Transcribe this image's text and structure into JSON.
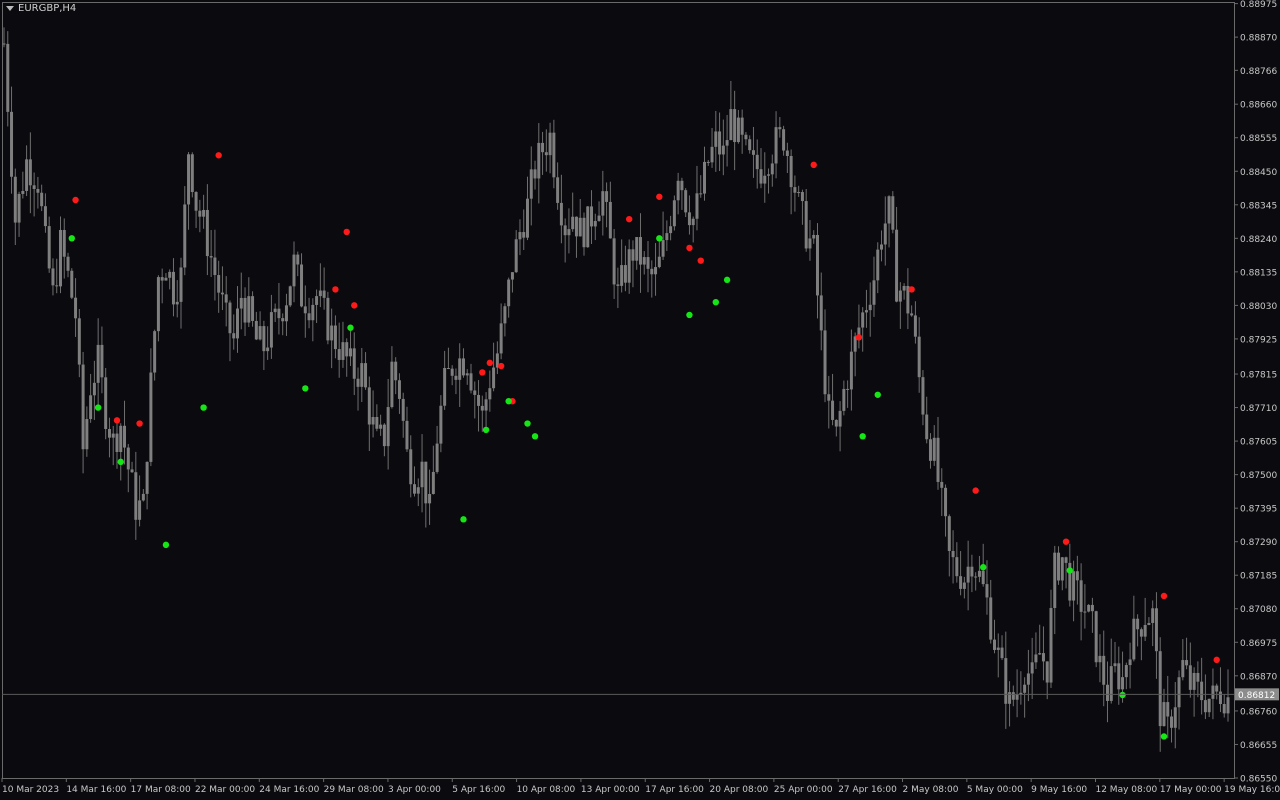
{
  "header": {
    "symbol_label": "EURGBP,H4"
  },
  "colors": {
    "background": "#0b0b0f",
    "frame": "#6a6a6a",
    "candle": "#7f7f7f",
    "wick": "#6f6f6f",
    "signal_up": "#ff1a1a",
    "signal_down": "#16e616",
    "current_price_line": "#5a5a5a",
    "price_tag_bg": "#8c8c8c",
    "price_tag_text": "#ffffff",
    "text": "#c8c8c8"
  },
  "chart_data": {
    "type": "candlestick",
    "title": "EURGBP,H4",
    "y_range": [
      0.8655,
      0.8898
    ],
    "y_ticks": [
      "0.88975",
      "0.88870",
      "0.88766",
      "0.88660",
      "0.88555",
      "0.88450",
      "0.88345",
      "0.88240",
      "0.88135",
      "0.88030",
      "0.87925",
      "0.87815",
      "0.87710",
      "0.87605",
      "0.87500",
      "0.87395",
      "0.87290",
      "0.87185",
      "0.87080",
      "0.86975",
      "0.86870",
      "0.86760",
      "0.86655",
      "0.86550"
    ],
    "x_ticks": [
      "10 Mar 2023",
      "14 Mar 16:00",
      "17 Mar 08:00",
      "22 Mar 00:00",
      "24 Mar 16:00",
      "29 Mar 08:00",
      "3 Apr 00:00",
      "5 Apr 16:00",
      "10 Apr 08:00",
      "13 Apr 00:00",
      "17 Apr 16:00",
      "20 Apr 08:00",
      "25 Apr 00:00",
      "27 Apr 16:00",
      "2 May 08:00",
      "5 May 00:00",
      "9 May 16:00",
      "12 May 08:00",
      "17 May 00:00",
      "19 May 16:00"
    ],
    "current_price": 0.86812,
    "current_price_label": "0.86812",
    "close_path": [
      [
        0,
        0.8885
      ],
      [
        3,
        0.883
      ],
      [
        6,
        0.8848
      ],
      [
        9,
        0.8842
      ],
      [
        11,
        0.8822
      ],
      [
        13,
        0.8806
      ],
      [
        15,
        0.8822
      ],
      [
        17,
        0.8812
      ],
      [
        19,
        0.88
      ],
      [
        21,
        0.8758
      ],
      [
        23,
        0.8778
      ],
      [
        25,
        0.8785
      ],
      [
        27,
        0.877
      ],
      [
        29,
        0.876
      ],
      [
        31,
        0.8766
      ],
      [
        33,
        0.8752
      ],
      [
        35,
        0.874
      ],
      [
        37,
        0.874
      ],
      [
        39,
        0.8778
      ],
      [
        41,
        0.8812
      ],
      [
        43,
        0.8816
      ],
      [
        45,
        0.8808
      ],
      [
        47,
        0.8812
      ],
      [
        49,
        0.8852
      ],
      [
        51,
        0.8835
      ],
      [
        53,
        0.8828
      ],
      [
        55,
        0.8818
      ],
      [
        57,
        0.8808
      ],
      [
        59,
        0.8798
      ],
      [
        61,
        0.8792
      ],
      [
        63,
        0.8806
      ],
      [
        65,
        0.88
      ],
      [
        67,
        0.8792
      ],
      [
        69,
        0.879
      ],
      [
        71,
        0.8796
      ],
      [
        73,
        0.88
      ],
      [
        75,
        0.8806
      ],
      [
        77,
        0.8816
      ],
      [
        79,
        0.8806
      ],
      [
        81,
        0.8804
      ],
      [
        83,
        0.8806
      ],
      [
        85,
        0.88
      ],
      [
        87,
        0.8794
      ],
      [
        89,
        0.879
      ],
      [
        91,
        0.8786
      ],
      [
        93,
        0.8782
      ],
      [
        95,
        0.8782
      ],
      [
        97,
        0.877
      ],
      [
        99,
        0.876
      ],
      [
        101,
        0.8762
      ],
      [
        103,
        0.8784
      ],
      [
        105,
        0.8776
      ],
      [
        107,
        0.8756
      ],
      [
        109,
        0.875
      ],
      [
        111,
        0.8752
      ],
      [
        113,
        0.8738
      ],
      [
        115,
        0.8762
      ],
      [
        117,
        0.8778
      ],
      [
        119,
        0.8784
      ],
      [
        121,
        0.8786
      ],
      [
        123,
        0.8786
      ],
      [
        125,
        0.8776
      ],
      [
        127,
        0.8768
      ],
      [
        129,
        0.878
      ],
      [
        131,
        0.8788
      ],
      [
        133,
        0.88
      ],
      [
        135,
        0.8816
      ],
      [
        137,
        0.8826
      ],
      [
        139,
        0.8834
      ],
      [
        141,
        0.8846
      ],
      [
        143,
        0.8852
      ],
      [
        145,
        0.8856
      ],
      [
        147,
        0.884
      ],
      [
        149,
        0.8828
      ],
      [
        151,
        0.8832
      ],
      [
        153,
        0.8826
      ],
      [
        155,
        0.8828
      ],
      [
        157,
        0.8834
      ],
      [
        159,
        0.8838
      ],
      [
        161,
        0.8822
      ],
      [
        163,
        0.8806
      ],
      [
        165,
        0.8814
      ],
      [
        167,
        0.882
      ],
      [
        169,
        0.8818
      ],
      [
        171,
        0.8812
      ],
      [
        173,
        0.8812
      ],
      [
        175,
        0.882
      ],
      [
        177,
        0.8832
      ],
      [
        179,
        0.8846
      ],
      [
        181,
        0.8836
      ],
      [
        183,
        0.883
      ],
      [
        185,
        0.8838
      ],
      [
        187,
        0.8848
      ],
      [
        189,
        0.8854
      ],
      [
        191,
        0.885
      ],
      [
        193,
        0.8862
      ],
      [
        195,
        0.8856
      ],
      [
        197,
        0.885
      ],
      [
        199,
        0.8846
      ],
      [
        201,
        0.8846
      ],
      [
        203,
        0.885
      ],
      [
        205,
        0.8854
      ],
      [
        207,
        0.8856
      ],
      [
        209,
        0.8846
      ],
      [
        211,
        0.8834
      ],
      [
        213,
        0.8826
      ],
      [
        215,
        0.882
      ],
      [
        217,
        0.8792
      ],
      [
        219,
        0.8768
      ],
      [
        221,
        0.8762
      ],
      [
        223,
        0.8776
      ],
      [
        225,
        0.8786
      ],
      [
        227,
        0.8796
      ],
      [
        229,
        0.8804
      ],
      [
        231,
        0.8812
      ],
      [
        233,
        0.8826
      ],
      [
        235,
        0.8832
      ],
      [
        237,
        0.881
      ],
      [
        239,
        0.8806
      ],
      [
        241,
        0.88
      ],
      [
        243,
        0.878
      ],
      [
        245,
        0.8764
      ],
      [
        247,
        0.8756
      ],
      [
        249,
        0.874
      ],
      [
        251,
        0.8724
      ],
      [
        253,
        0.872
      ],
      [
        255,
        0.8718
      ],
      [
        257,
        0.8724
      ],
      [
        259,
        0.8718
      ],
      [
        261,
        0.871
      ],
      [
        263,
        0.8698
      ],
      [
        265,
        0.8688
      ],
      [
        267,
        0.8678
      ],
      [
        269,
        0.8682
      ],
      [
        271,
        0.869
      ],
      [
        273,
        0.8686
      ],
      [
        275,
        0.8694
      ],
      [
        277,
        0.869
      ],
      [
        279,
        0.872
      ],
      [
        281,
        0.8724
      ],
      [
        283,
        0.8716
      ],
      [
        285,
        0.8712
      ],
      [
        287,
        0.8708
      ],
      [
        289,
        0.8702
      ],
      [
        291,
        0.869
      ],
      [
        293,
        0.8682
      ],
      [
        295,
        0.8688
      ],
      [
        297,
        0.8686
      ],
      [
        299,
        0.8698
      ],
      [
        301,
        0.8702
      ],
      [
        303,
        0.8706
      ],
      [
        305,
        0.8706
      ],
      [
        307,
        0.8676
      ],
      [
        309,
        0.867
      ],
      [
        311,
        0.868
      ],
      [
        313,
        0.869
      ],
      [
        315,
        0.8684
      ],
      [
        317,
        0.8682
      ],
      [
        319,
        0.868
      ],
      [
        321,
        0.868
      ],
      [
        323,
        0.8682
      ],
      [
        325,
        0.868
      ]
    ],
    "signals_up": [
      [
        19,
        0.8836
      ],
      [
        30,
        0.8767
      ],
      [
        36,
        0.8766
      ],
      [
        57,
        0.885
      ],
      [
        88,
        0.8808
      ],
      [
        91,
        0.8826
      ],
      [
        93,
        0.8803
      ],
      [
        127,
        0.8782
      ],
      [
        129,
        0.8785
      ],
      [
        132,
        0.8784
      ],
      [
        135,
        0.8773
      ],
      [
        166,
        0.883
      ],
      [
        174,
        0.8837
      ],
      [
        182,
        0.8821
      ],
      [
        185,
        0.8817
      ],
      [
        215,
        0.8847
      ],
      [
        227,
        0.8793
      ],
      [
        241,
        0.8808
      ],
      [
        258,
        0.8745
      ],
      [
        282,
        0.8729
      ],
      [
        308,
        0.8712
      ],
      [
        322,
        0.8692
      ]
    ],
    "signals_down": [
      [
        18,
        0.8824
      ],
      [
        25,
        0.8771
      ],
      [
        31,
        0.8754
      ],
      [
        43,
        0.8728
      ],
      [
        53,
        0.8771
      ],
      [
        80,
        0.8777
      ],
      [
        92,
        0.8796
      ],
      [
        122,
        0.8736
      ],
      [
        128,
        0.8764
      ],
      [
        134,
        0.8773
      ],
      [
        139,
        0.8766
      ],
      [
        141,
        0.8762
      ],
      [
        174,
        0.8824
      ],
      [
        182,
        0.88
      ],
      [
        189,
        0.8804
      ],
      [
        192,
        0.8811
      ],
      [
        228,
        0.8762
      ],
      [
        232,
        0.8775
      ],
      [
        260,
        0.8721
      ],
      [
        283,
        0.872
      ],
      [
        297,
        0.8681
      ],
      [
        308,
        0.8668
      ]
    ]
  }
}
